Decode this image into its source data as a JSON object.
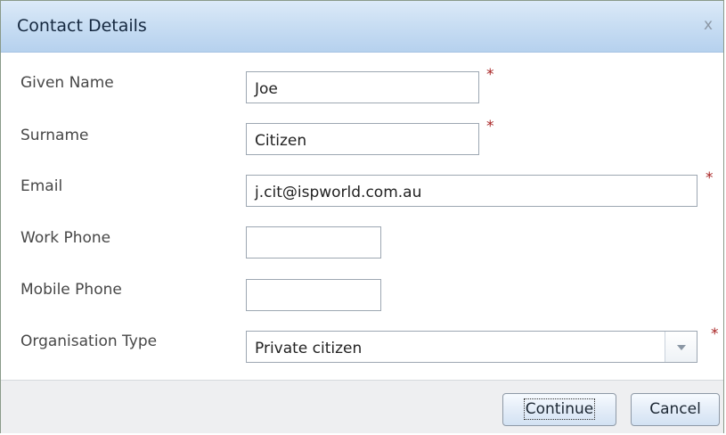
{
  "dialog": {
    "title": "Contact Details",
    "close_label": "x"
  },
  "form": {
    "required_marker": "*",
    "fields": [
      {
        "label": "Given Name",
        "value": "Joe",
        "required": true
      },
      {
        "label": "Surname",
        "value": "Citizen",
        "required": true
      },
      {
        "label": "Email",
        "value": "j.cit@ispworld.com.au",
        "required": true
      },
      {
        "label": "Work Phone",
        "value": "",
        "required": false
      },
      {
        "label": "Mobile Phone",
        "value": "",
        "required": false
      },
      {
        "label": "Organisation Type",
        "value": "Private citizen",
        "required": true
      }
    ]
  },
  "buttons": {
    "continue_label": "Continue",
    "cancel_label": "Cancel"
  },
  "icons": {
    "dropdown": "chevron-down-icon",
    "close": "close-icon"
  },
  "colors": {
    "title_bar": "#c9def3",
    "required_marker": "#a82323",
    "footer": "#eeeff1"
  }
}
